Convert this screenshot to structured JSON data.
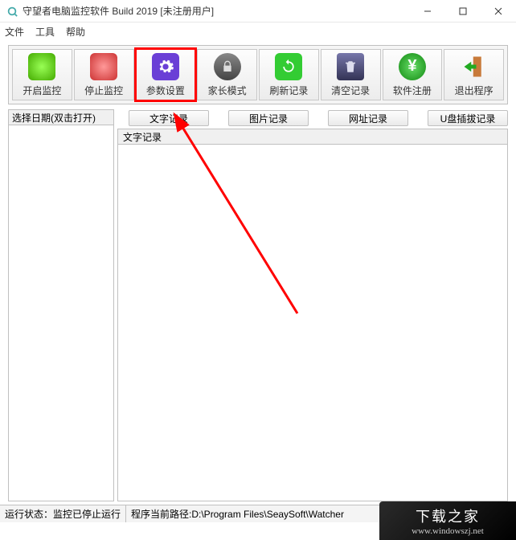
{
  "title": "守望者电脑监控软件    Build 2019      [未注册用户]",
  "menu": {
    "file": "文件",
    "tools": "工具",
    "help": "帮助"
  },
  "toolbar": [
    {
      "label": "开启监控",
      "name": "start-monitor"
    },
    {
      "label": "停止监控",
      "name": "stop-monitor"
    },
    {
      "label": "参数设置",
      "name": "settings"
    },
    {
      "label": "家长模式",
      "name": "parent-mode"
    },
    {
      "label": "刷新记录",
      "name": "refresh"
    },
    {
      "label": "清空记录",
      "name": "clear"
    },
    {
      "label": "软件注册",
      "name": "register"
    },
    {
      "label": "退出程序",
      "name": "exit"
    }
  ],
  "left_header": "选择日期(双击打开)",
  "tabs": [
    {
      "label": "文字记录"
    },
    {
      "label": "图片记录"
    },
    {
      "label": "网址记录"
    },
    {
      "label": "U盘插拔记录"
    }
  ],
  "sub_header": "文字记录",
  "status": {
    "run_state": "运行状态：监控已停止运行",
    "path": "程序当前路径:D:\\Program Files\\SeaySoft\\Watcher"
  },
  "watermark": {
    "text": "下载之家",
    "url": "www.windowszj.net"
  }
}
